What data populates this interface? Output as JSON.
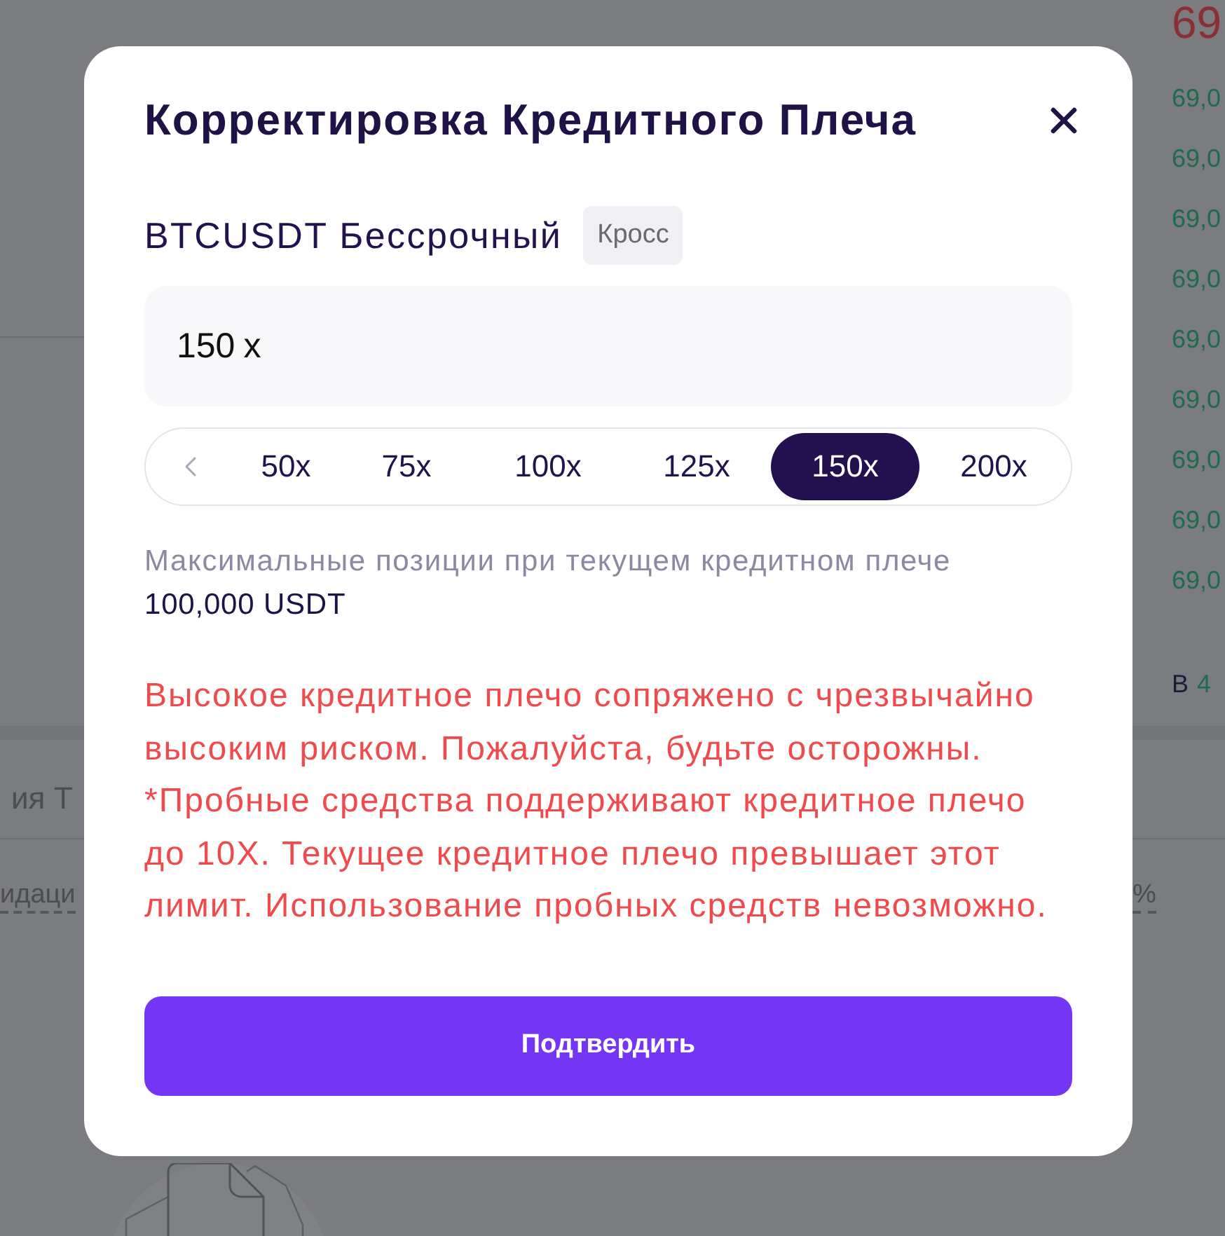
{
  "backdrop": {
    "top_price": "69",
    "prices": [
      "69,0",
      "69,0",
      "69,0",
      "69,0",
      "69,0",
      "69,0",
      "69,0",
      "69,0",
      "69,0"
    ],
    "side_label": "В",
    "side_value": "4",
    "section_title": "ия Т",
    "column_label": "идаци",
    "column_suffix": "%"
  },
  "dialog": {
    "title": "Корректировка Кредитного Плеча",
    "symbol": "BTCUSDT Бессрочный",
    "margin_mode": "Кросс",
    "leverage_field": {
      "value": "150",
      "suffix": "x"
    },
    "leverage_options": [
      {
        "label": "50x",
        "selected": false
      },
      {
        "label": "75x",
        "selected": false
      },
      {
        "label": "100x",
        "selected": false
      },
      {
        "label": "125x",
        "selected": false
      },
      {
        "label": "150x",
        "selected": true
      },
      {
        "label": "200x",
        "selected": false
      }
    ],
    "max_position": {
      "label": "Максимальные позиции при текущем кредитном плече",
      "value": "100,000 USDT"
    },
    "warnings": [
      "Высокое кредитное плечо сопряжено с чрезвычайно высоким риском. Пожалуйста, будьте осторожны.",
      "*Пробные средства поддерживают кредитное плечо до 10X. Текущее кредитное плечо превышает этот лимит. Использование пробных средств невозможно."
    ],
    "confirm_button": "Подтвердить"
  }
}
